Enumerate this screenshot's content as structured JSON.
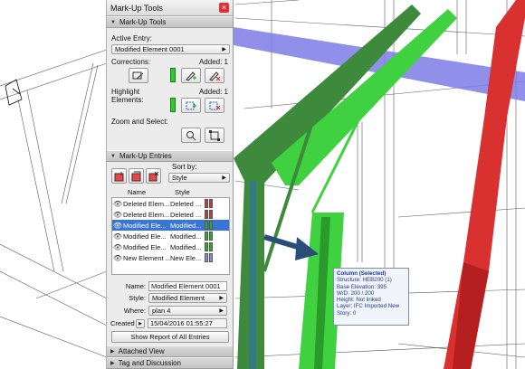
{
  "palette": {
    "title": "Mark-Up Tools",
    "close_glyph": "×",
    "section_tools": "Mark-Up Tools",
    "active_entry_label": "Active Entry:",
    "active_entry_value": "Modified Element 0001",
    "corrections_label": "Corrections:",
    "corrections_added": "Added: 1",
    "highlight_label_1": "Highlight",
    "highlight_label_2": "Elements:",
    "highlight_added": "Added: 1",
    "zoom_label": "Zoom and Select:",
    "section_entries": "Mark-Up Entries",
    "sort_by_label": "Sort by:",
    "sort_by_value": "Style",
    "col_name": "Name",
    "col_style": "Style",
    "entries": [
      {
        "name": "Deleted Elem...",
        "style": "Deleted ...",
        "c1": "#c43b3b",
        "c2": "#c43b3b"
      },
      {
        "name": "Deleted Elem...",
        "style": "Deleted ...",
        "c1": "#c43b3b",
        "c2": "#c43b3b"
      },
      {
        "name": "Modified Ele...",
        "style": "Modified...",
        "c1": "#2eab2e",
        "c2": "#2eab2e"
      },
      {
        "name": "Modified Ele...",
        "style": "Modified...",
        "c1": "#2eab2e",
        "c2": "#2eab2e"
      },
      {
        "name": "Modified Ele...",
        "style": "Modified...",
        "c1": "#2eab2e",
        "c2": "#2eab2e"
      },
      {
        "name": "New Element ...",
        "style": "New Ele...",
        "c1": "#8a8ad8",
        "c2": "#8a8ad8"
      }
    ],
    "selected_index": 2,
    "name_label": "Name:",
    "name_value": "Modified Element 0001",
    "style_label": "Style:",
    "style_value": "Modified Element",
    "where_label": "Where:",
    "where_value": "plan 4",
    "created_label": "Created",
    "created_value": "15/04/2016 01:55:27",
    "report_button": "Show Report of All Entries",
    "section_attached": "Attached View",
    "section_tag": "Tag and Discussion"
  },
  "tooltip": {
    "title": "Column (Selected)",
    "lines": [
      "Structure: HEB200 (1)",
      "Base Elevation: 395",
      "W/D: 200 / 200",
      "Height: Not linked",
      "Layer: IFC Imported New",
      "Story: 0"
    ]
  },
  "colors": {
    "modified_green": "#2eab2e",
    "deleted_red": "#d93030",
    "new_blue": "#7b7bd9",
    "selection_blue": "#3875d7"
  }
}
